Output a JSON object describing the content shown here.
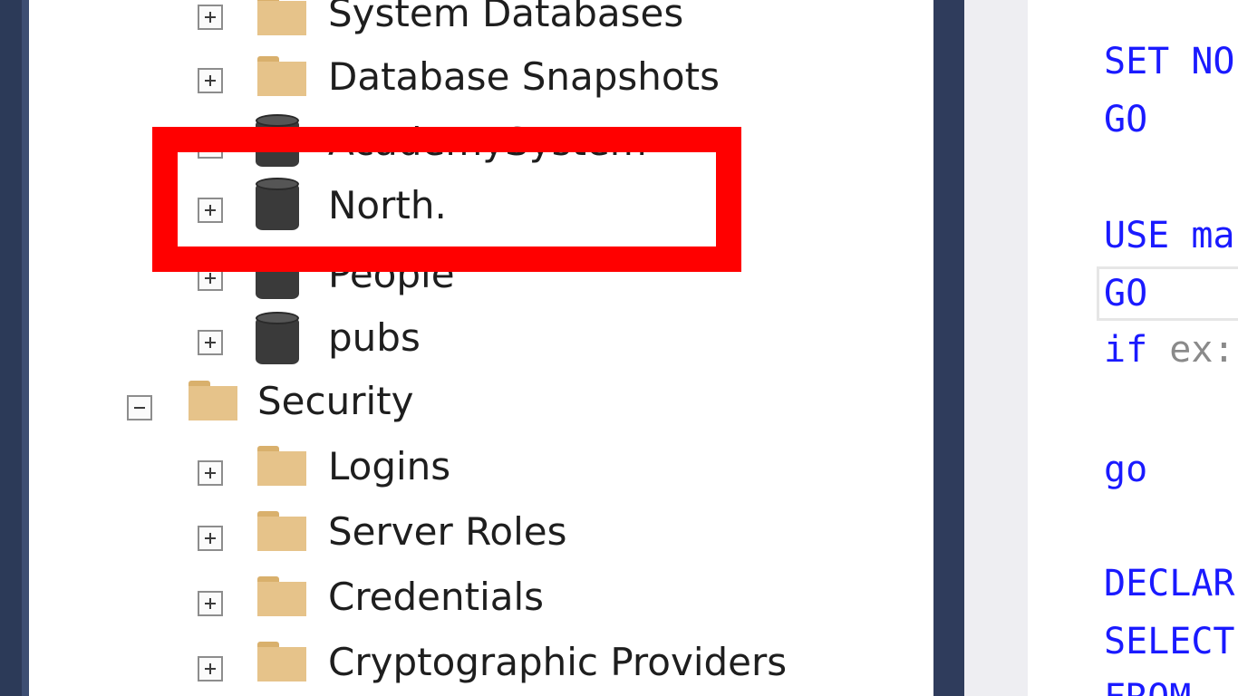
{
  "tree": {
    "items": [
      {
        "label": "System Databases"
      },
      {
        "label": "Database Snapshots"
      },
      {
        "label": "AcademySystem"
      },
      {
        "label": "North."
      },
      {
        "label": "People"
      },
      {
        "label": "pubs"
      },
      {
        "label": "Security"
      },
      {
        "label": "Logins"
      },
      {
        "label": "Server Roles"
      },
      {
        "label": "Credentials"
      },
      {
        "label": "Cryptographic Providers"
      }
    ]
  },
  "editor": {
    "lines": [
      {
        "text": "SET NO"
      },
      {
        "text": "GO"
      },
      {
        "text": "USE ma"
      },
      {
        "text": "GO"
      },
      {
        "text": "if",
        "muted": "ex:"
      },
      {
        "text": "go"
      },
      {
        "text": "DECLAR"
      },
      {
        "text": "SELECT"
      },
      {
        "text": "FROM"
      }
    ]
  },
  "colors": {
    "highlight": "#ff0000",
    "keyword": "#1a1aff",
    "folder": "#e6c38a",
    "database": "#3a3a3a"
  }
}
